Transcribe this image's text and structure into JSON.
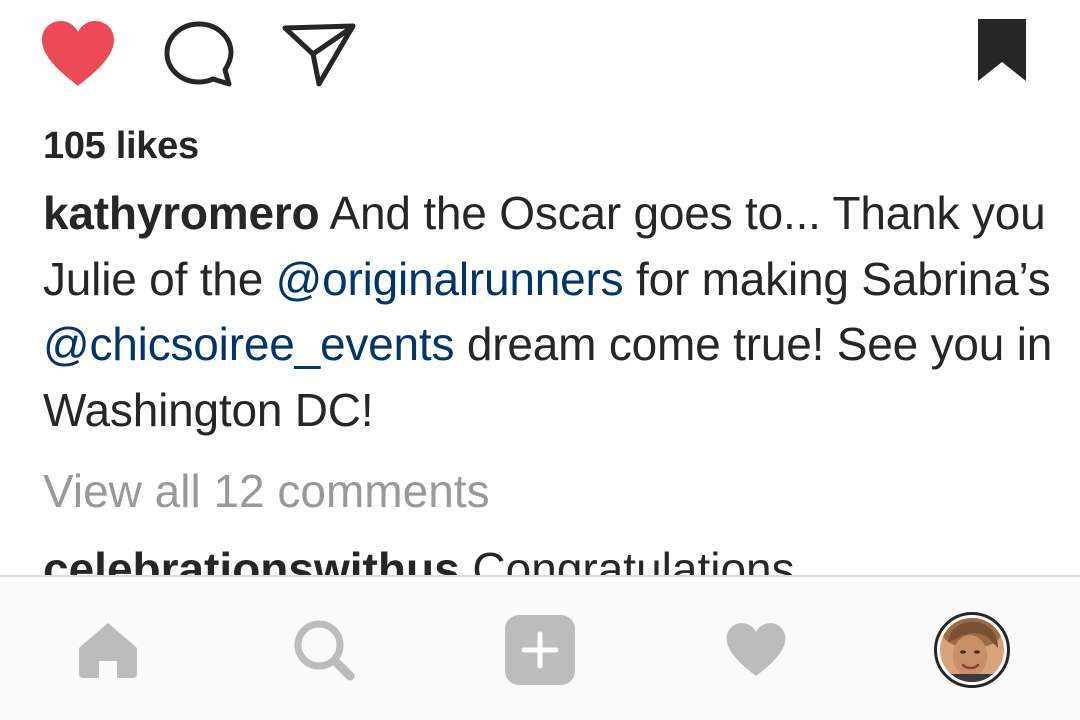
{
  "actions": {
    "like_icon": "heart-filled-icon",
    "comment_icon": "comment-bubble-icon",
    "share_icon": "paper-plane-icon",
    "save_icon": "bookmark-filled-icon",
    "like_color": "#ed4956"
  },
  "post": {
    "likes": "105 likes",
    "caption": {
      "username": "kathyromero",
      "text_1": " And the Oscar goes to... Thank you Julie of the ",
      "mention_1": "@originalrunners",
      "text_2": " for making Sabrina’s ",
      "mention_2": "@chicsoiree_events",
      "text_3": " dream come true! See you in Washington DC!"
    },
    "view_comments": "View all 12 comments",
    "comment": {
      "username": "celebrationswithus",
      "text": " Congratulations"
    }
  },
  "bottom_nav": {
    "items": [
      {
        "icon": "home-icon"
      },
      {
        "icon": "search-icon"
      },
      {
        "icon": "add-post-icon"
      },
      {
        "icon": "activity-heart-icon"
      },
      {
        "icon": "profile-avatar"
      }
    ]
  }
}
